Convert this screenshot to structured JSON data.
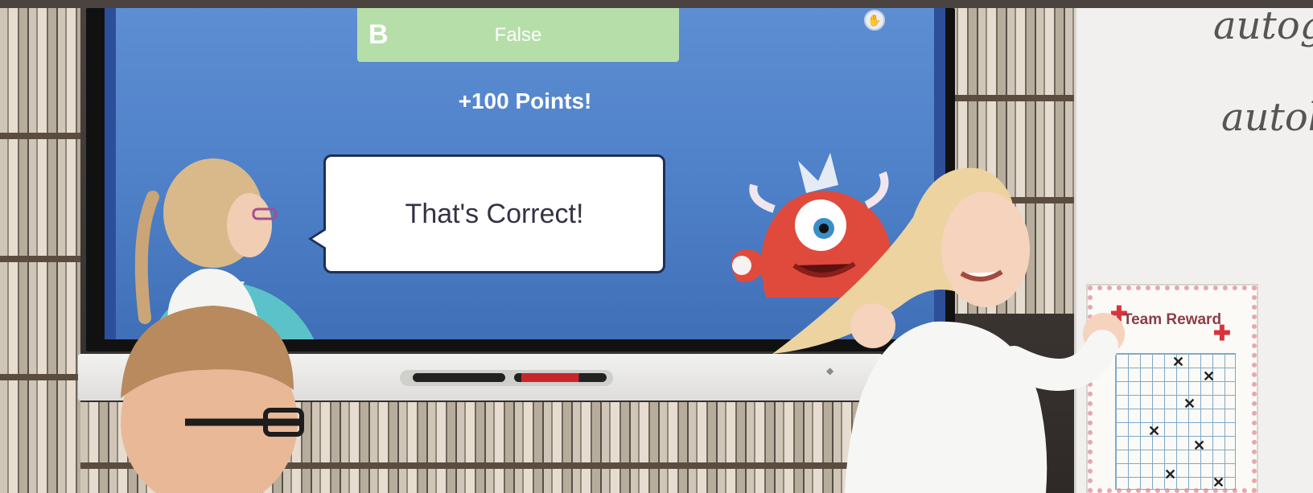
{
  "screen": {
    "answer_letter": "B",
    "answer_text": "False",
    "points": "+100 Points!",
    "feedback": "That's Correct!"
  },
  "chart": {
    "title": "Team Reward"
  },
  "wall": {
    "word1": "autog",
    "word2": "autobi"
  },
  "colors": {
    "screen_blue": "#5d8ed3",
    "answer_green": "#b6dea9",
    "monster_red": "#e04a3c"
  }
}
